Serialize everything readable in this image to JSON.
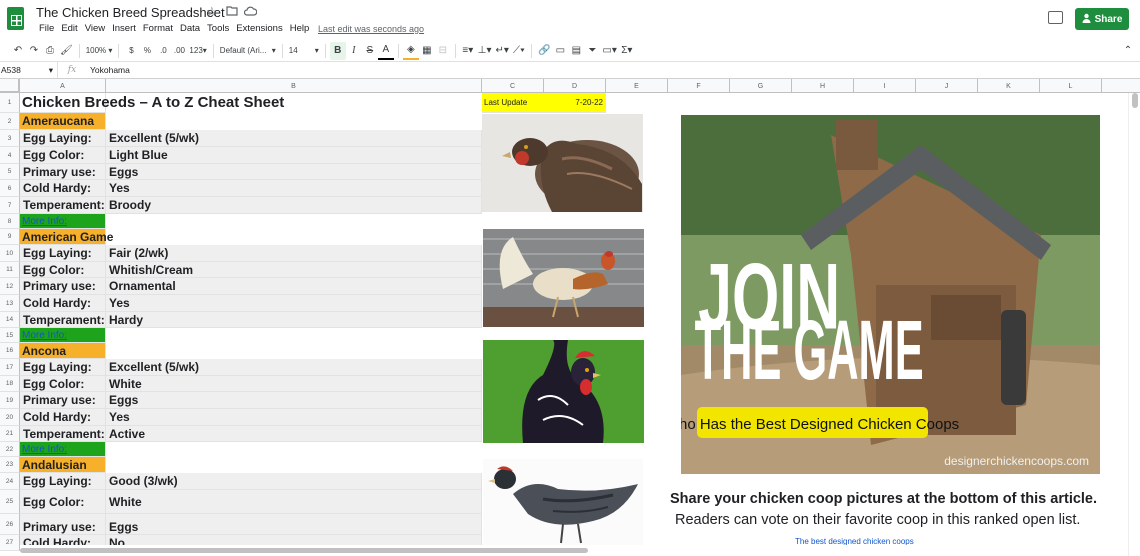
{
  "app": {
    "title": "The Chicken Breed Spreadsheet",
    "menus": [
      "File",
      "Edit",
      "View",
      "Insert",
      "Format",
      "Data",
      "Tools",
      "Extensions",
      "Help"
    ],
    "last_edit": "Last edit was seconds ago",
    "share_label": "Share",
    "accent_color": "#1e8e3e"
  },
  "toolbar": {
    "zoom": "100%",
    "currency": "$",
    "percent": "%",
    "decimal_decrease": ".0",
    "decimal_increase": ".00",
    "number_format": "123",
    "font": "Default (Ari...",
    "font_size": "14",
    "bold": "B",
    "italic": "I",
    "strike": "S",
    "text_color": "A"
  },
  "formula_bar": {
    "cell_ref": "A538",
    "fx": "fx",
    "value": "Yokohama"
  },
  "columns": [
    "A",
    "B",
    "C",
    "D",
    "E",
    "F",
    "G",
    "H",
    "I",
    "J",
    "K",
    "L"
  ],
  "sheet": {
    "title": "Chicken Breeds – A to Z Cheat Sheet",
    "last_update_label": "Last Update",
    "last_update_value": "7-20-22",
    "rows": [
      {
        "n": "1"
      },
      {
        "n": "2"
      },
      {
        "n": "3"
      },
      {
        "n": "4"
      },
      {
        "n": "5"
      },
      {
        "n": "6"
      },
      {
        "n": "7"
      },
      {
        "n": "8"
      },
      {
        "n": "9"
      },
      {
        "n": "10"
      },
      {
        "n": "11"
      },
      {
        "n": "12"
      },
      {
        "n": "13"
      },
      {
        "n": "14"
      },
      {
        "n": "15"
      },
      {
        "n": "16"
      },
      {
        "n": "17"
      },
      {
        "n": "18"
      },
      {
        "n": "19"
      },
      {
        "n": "20"
      },
      {
        "n": "21"
      },
      {
        "n": "22"
      },
      {
        "n": "23"
      },
      {
        "n": "24"
      },
      {
        "n": "25"
      },
      {
        "n": "26"
      },
      {
        "n": "27"
      }
    ],
    "breeds": [
      {
        "name": "Ameraucana",
        "egg_laying_label": "Egg Laying:",
        "egg_laying": "Excellent (5/wk)",
        "egg_color_label": "Egg Color:",
        "egg_color": "Light Blue",
        "primary_use_label": "Primary use:",
        "primary_use": "Eggs",
        "cold_hardy_label": "Cold Hardy:",
        "cold_hardy": "Yes",
        "temperament_label": "Temperament:",
        "temperament": "Broody",
        "more_info": "More Info:"
      },
      {
        "name": "American Game",
        "egg_laying_label": "Egg Laying:",
        "egg_laying": "Fair (2/wk)",
        "egg_color_label": "Egg Color:",
        "egg_color": "Whitish/Cream",
        "primary_use_label": "Primary use:",
        "primary_use": "Ornamental",
        "cold_hardy_label": "Cold Hardy:",
        "cold_hardy": "Yes",
        "temperament_label": "Temperament:",
        "temperament": "Hardy",
        "more_info": "More Info:"
      },
      {
        "name": "Ancona",
        "egg_laying_label": "Egg Laying:",
        "egg_laying": "Excellent (5/wk)",
        "egg_color_label": "Egg Color:",
        "egg_color": "White",
        "primary_use_label": "Primary use:",
        "primary_use": "Eggs",
        "cold_hardy_label": "Cold Hardy:",
        "cold_hardy": "Yes",
        "temperament_label": "Temperament:",
        "temperament": "Active",
        "more_info": "More Info:"
      },
      {
        "name": "Andalusian",
        "egg_laying_label": "Egg Laying:",
        "egg_laying": "Good (3/wk)",
        "egg_color_label": "Egg Color:",
        "egg_color": "White",
        "primary_use_label": "Primary use:",
        "primary_use": "Eggs",
        "cold_hardy_label": "Cold Hardy:",
        "cold_hardy": "No"
      }
    ]
  },
  "ad": {
    "headline_1": "JOIN",
    "headline_2": "THE GAME",
    "tagline": "Who Has the Best Designed Chicken Coops",
    "watermark": "designerchickencoops.com",
    "caption_1": "Share your chicken coop pictures at the bottom of this article.",
    "caption_2": "Readers can vote on their favorite coop in this ranked open list.",
    "link": "The best designed chicken coops"
  },
  "colors": {
    "breed_header": "#f6b02a",
    "more_info": "#1ea31c",
    "last_update": "#ffff00",
    "label_gray": "#efefef"
  }
}
